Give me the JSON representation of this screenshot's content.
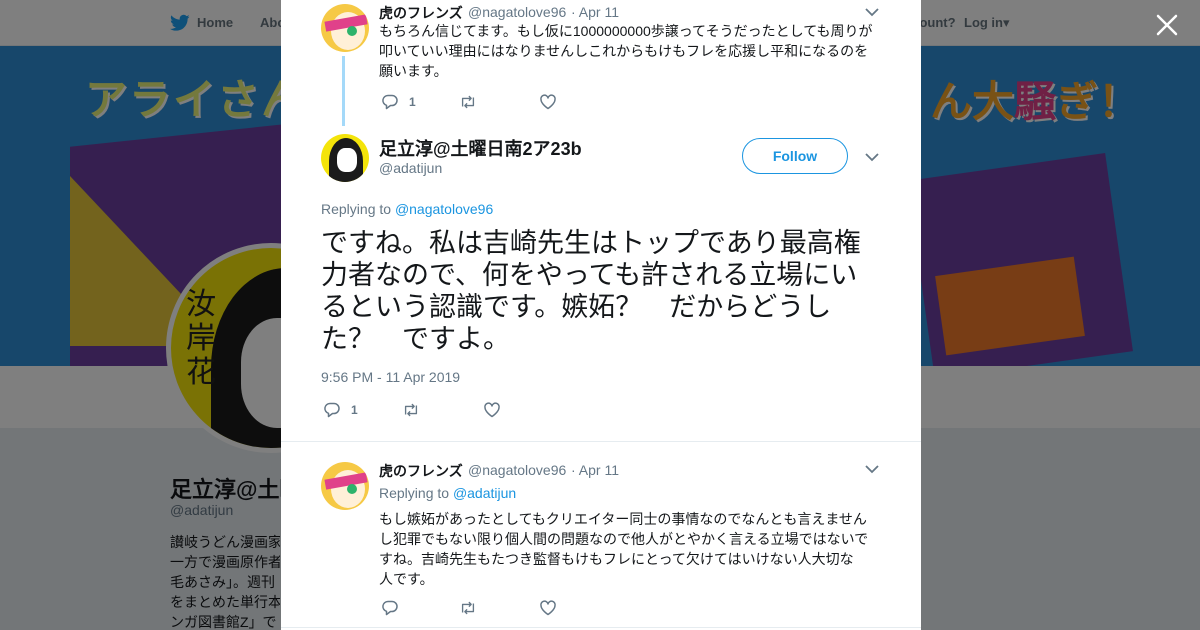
{
  "colors": {
    "brand_blue": "#1b95e0",
    "thread_line": "#a4d9f9",
    "overlay": "rgba(0,0,0,0.5)"
  },
  "background_page": {
    "nav": {
      "home_label": "Home",
      "about_label": "Abo",
      "account_prompt": "ccount?",
      "login_label": "Log in"
    },
    "banner": {
      "title_left": "アライさん",
      "title_right_a": "ん大",
      "title_right_b": "騒",
      "title_right_c": "ぎ！"
    },
    "profile": {
      "name": "足立淳@土曜",
      "handle": "@adatijun",
      "bio_lines": [
        "讃岐うどん漫画家",
        "一方で漫画原作者",
        "毛あさみ」。週刊",
        "をまとめた単行本",
        "ンガ図書館Z」で"
      ]
    }
  },
  "modal": {
    "parent_tweet": {
      "author_name": "虎のフレンズ",
      "handle": "@nagatolove96",
      "date": "· Apr 11",
      "text_lines": [
        "もちろん信じてます。もし仮に1000000000歩譲ってそうだったとしても周りが",
        "叩いていい理由にはなりませんしこれからもけもフレを応援し平和になるのを",
        "願います。"
      ],
      "reply_count": "1",
      "icons": [
        "reply-icon",
        "retweet-icon",
        "like-icon"
      ]
    },
    "main_tweet": {
      "author_name": "足立淳@土曜日南2ア23b",
      "handle": "@adatijun",
      "follow_label": "Follow",
      "replying_prefix": "Replying to",
      "replying_handle": "@nagatolove96",
      "text_lines": [
        "ですね。私は吉崎先生はトップであり最高権",
        "力者なので、何をやっても許される立場にい",
        "るという認識です。嫉妬？　だからどうし",
        "た？　ですよ。"
      ],
      "timestamp": "9:56 PM - 11 Apr 2019",
      "reply_count": "1"
    },
    "reply_tweet": {
      "author_name": "虎のフレンズ",
      "handle": "@nagatolove96",
      "date": "· Apr 11",
      "replying_prefix": "Replying to",
      "replying_handle": "@adatijun",
      "text_lines": [
        "もし嫉妬があったとしてもクリエイター同士の事情なのでなんとも言えません",
        "し犯罪でもない限り個人間の問題なので他人がとやかく言える立場ではないで",
        "すね。吉崎先生もたつき監督もけもフレにとって欠けてはいけない人大切な",
        "人です。"
      ]
    }
  }
}
